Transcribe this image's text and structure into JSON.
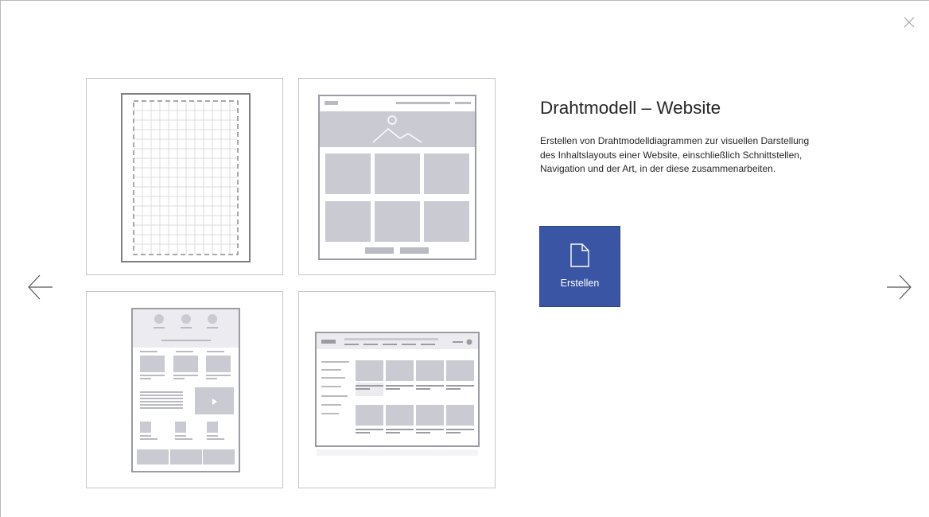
{
  "dialog": {
    "close_icon": "close-icon",
    "prev_icon": "arrow-left-icon",
    "next_icon": "arrow-right-icon"
  },
  "template": {
    "title": "Drahtmodell – Website",
    "description": "Erstellen von Drahtmodelldiagrammen zur visuellen Darstellung des Inhaltslayouts einer Website, einschließlich Schnittstellen, Navigation und der Art, in der diese zusammenarbeiten.",
    "create_label": "Erstellen",
    "create_icon": "document-icon",
    "accent_color": "#3955a3"
  },
  "thumbnails": [
    {
      "name": "blank-grid-page"
    },
    {
      "name": "website-homepage-wireframe"
    },
    {
      "name": "mobile-page-wireframe"
    },
    {
      "name": "web-app-wireframe"
    }
  ]
}
